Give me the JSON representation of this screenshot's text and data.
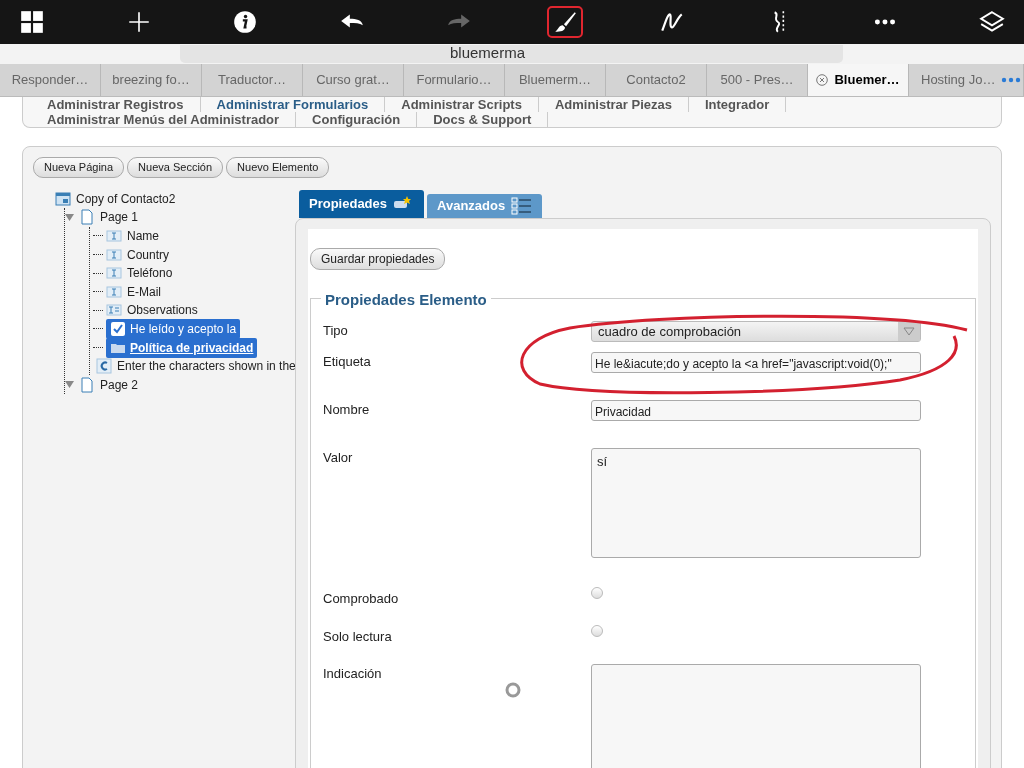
{
  "toolbar": [
    {
      "kind": "grid",
      "selected": false,
      "disabled": false
    },
    {
      "kind": "plus",
      "selected": false,
      "disabled": false
    },
    {
      "kind": "info",
      "selected": false,
      "disabled": false
    },
    {
      "kind": "undo",
      "selected": false,
      "disabled": false
    },
    {
      "kind": "redo",
      "selected": false,
      "disabled": true
    },
    {
      "kind": "brush",
      "selected": true,
      "disabled": false
    },
    {
      "kind": "pen",
      "selected": false,
      "disabled": false
    },
    {
      "kind": "line",
      "selected": false,
      "disabled": false
    },
    {
      "kind": "more",
      "selected": false,
      "disabled": false
    },
    {
      "kind": "layers",
      "selected": false,
      "disabled": false
    }
  ],
  "address_bar": {
    "text": "bluemerma"
  },
  "browser_tabs": [
    {
      "label": "Responder…",
      "selected": false
    },
    {
      "label": "breezing fo…",
      "selected": false
    },
    {
      "label": "Traductor…",
      "selected": false
    },
    {
      "label": "Curso grat…",
      "selected": false
    },
    {
      "label": "Formulario…",
      "selected": false
    },
    {
      "label": "Bluemerm…",
      "selected": false
    },
    {
      "label": "Contacto2",
      "selected": false
    },
    {
      "label": "500 - Pres…",
      "selected": false
    },
    {
      "label": "Bluemer…",
      "selected": true
    },
    {
      "label": "Hosting Jo…",
      "selected": false
    }
  ],
  "admin_menu": {
    "row_1": [
      "Administrar Registros",
      "Administrar Formularios",
      "Administrar Scripts",
      "Administrar Piezas",
      "Integrador"
    ],
    "row_2": [
      "Administrar Menús del Administrador",
      "Configuración",
      "Docs & Support"
    ]
  },
  "builder_buttons": [
    "Nueva Página",
    "Nueva Sección",
    "Nuevo Elemento"
  ],
  "tree": {
    "label": "Copy of Contacto2",
    "kind": "form",
    "children": [
      {
        "label": "Page 1",
        "kind": "page",
        "expanded": true,
        "children": [
          {
            "label": "Name",
            "kind": "text",
            "selected": false
          },
          {
            "label": "Country",
            "kind": "text",
            "selected": false
          },
          {
            "label": "Teléfono",
            "kind": "text",
            "selected": false
          },
          {
            "label": "E-Mail",
            "kind": "text",
            "selected": false
          },
          {
            "label": "Observations",
            "kind": "textarea",
            "selected": false
          },
          {
            "label": "He leído y acepto la",
            "kind": "checkbox",
            "selected": true
          },
          {
            "label": "Política de privacidad",
            "kind": "folder",
            "selected": true
          },
          {
            "label": "Enter the characters shown in the",
            "kind": "captcha",
            "selected": false
          }
        ]
      },
      {
        "label": "Page 2",
        "kind": "page",
        "expanded": true
      }
    ]
  },
  "panel_tabs": [
    {
      "label": "Propiedades",
      "selected": true
    },
    {
      "label": "Avanzados",
      "selected": false
    }
  ],
  "save_button": "Guardar propiedades",
  "section_title": "Propiedades Elemento",
  "fields": [
    {
      "label": "Tipo",
      "kind": "select",
      "value": "cuadro de comprobación"
    },
    {
      "label": "Etiqueta",
      "kind": "text",
      "value": "He le&iacute;do y acepto la <a href=\"javascript:void(0);\""
    },
    {
      "label": "Nombre",
      "kind": "text",
      "value": "Privacidad"
    },
    {
      "label": "Valor",
      "kind": "textarea",
      "value": "sí"
    },
    {
      "label": "Comprobado",
      "kind": "checkbox",
      "checked": false
    },
    {
      "label": "Solo lectura",
      "kind": "checkbox",
      "checked": false
    },
    {
      "label": "Indicación",
      "kind": "textarea",
      "spinner": true
    }
  ],
  "annotation": {
    "kind": "ellipse",
    "color": "#d3202f"
  }
}
